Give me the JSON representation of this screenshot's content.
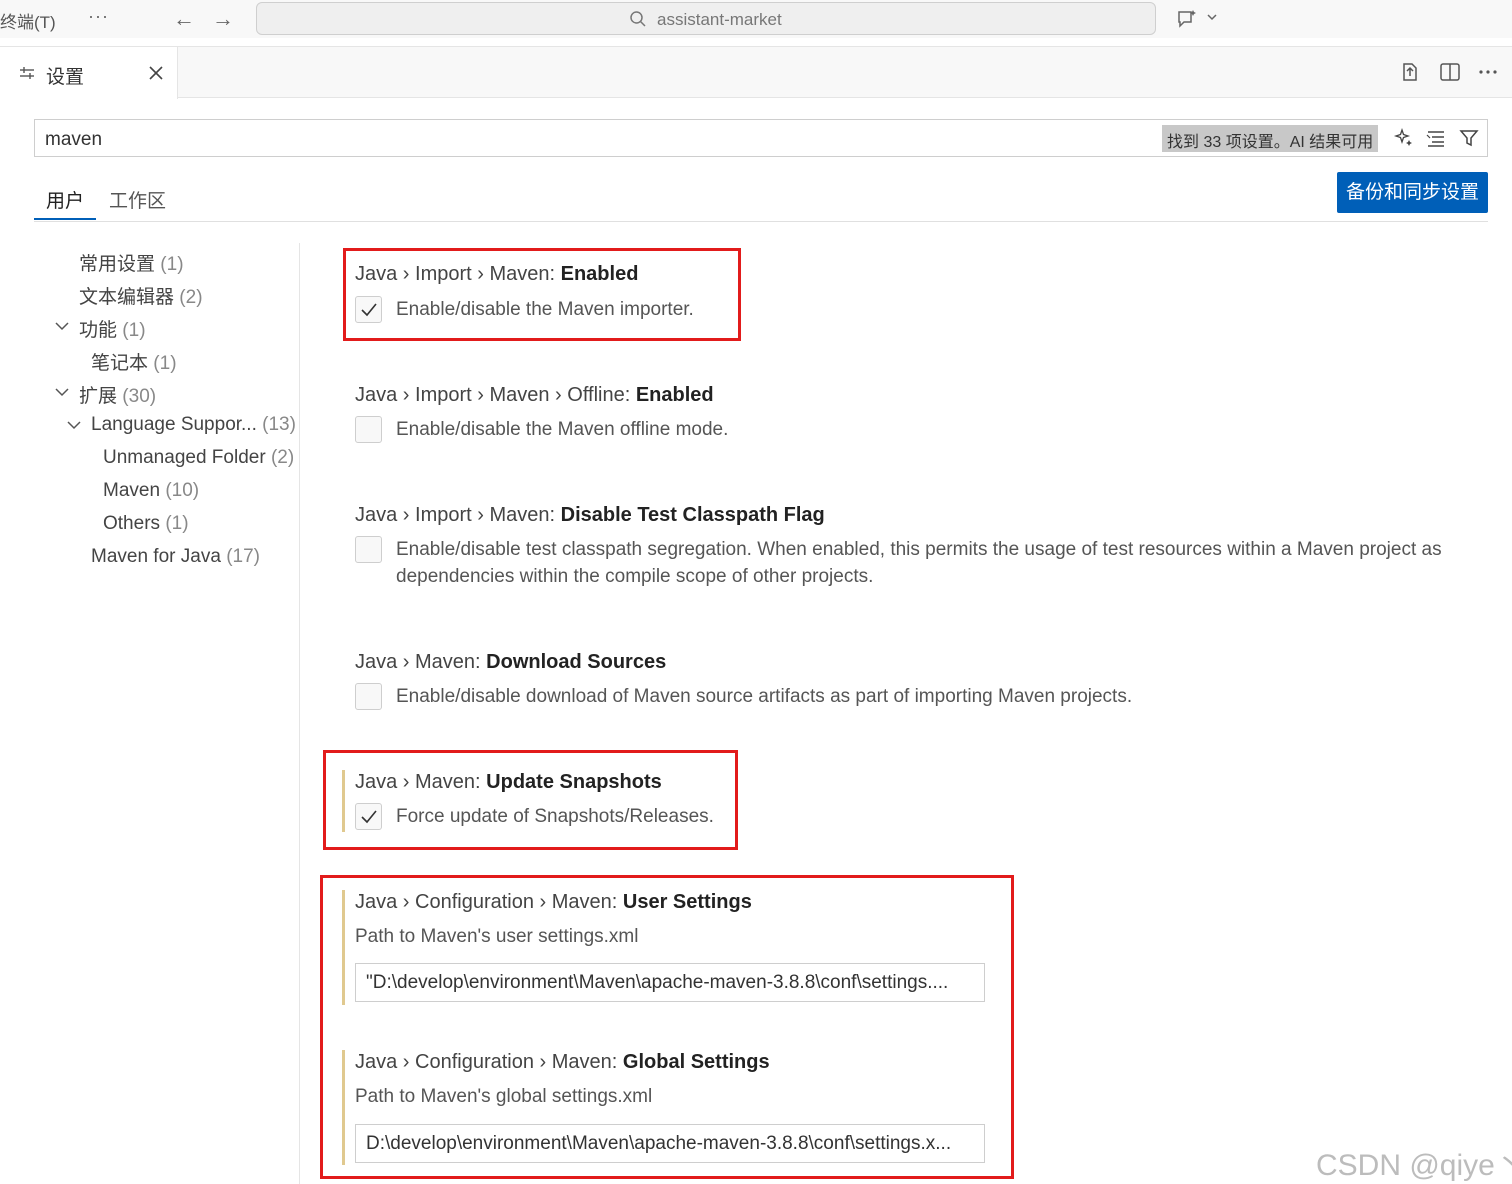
{
  "titlebar": {
    "menu_terminal": "终端(T)",
    "more": "···",
    "back": "←",
    "forward": "→",
    "command_center_text": "assistant-market"
  },
  "tab": {
    "label": "设置"
  },
  "search": {
    "value": "maven",
    "result_count": "找到 33 项设置。AI 结果可用"
  },
  "scopes": {
    "user": "用户",
    "workspace": "工作区"
  },
  "sync_button": "备份和同步设置",
  "toc": [
    {
      "label": "常用设置",
      "count": "(1)"
    },
    {
      "label": "文本编辑器",
      "count": "(2)"
    },
    {
      "label": "功能",
      "count": "(1)"
    },
    {
      "label": "笔记本",
      "count": "(1)"
    },
    {
      "label": "扩展",
      "count": "(30)"
    },
    {
      "label": "Language Suppor...",
      "count": "(13)"
    },
    {
      "label": "Unmanaged Folder",
      "count": "(2)"
    },
    {
      "label": "Maven",
      "count": "(10)"
    },
    {
      "label": "Others",
      "count": "(1)"
    },
    {
      "label": "Maven for Java",
      "count": "(17)"
    }
  ],
  "settings": [
    {
      "prefix": "Java › Import › Maven: ",
      "name": "Enabled",
      "description": "Enable/disable the Maven importer.",
      "checked": true
    },
    {
      "prefix": "Java › Import › Maven › Offline: ",
      "name": "Enabled",
      "description": "Enable/disable the Maven offline mode.",
      "checked": false
    },
    {
      "prefix": "Java › Import › Maven: ",
      "name": "Disable Test Classpath Flag",
      "description": "Enable/disable test classpath segregation. When enabled, this permits the usage of test resources within a Maven project as",
      "description2": "dependencies within the compile scope of other projects.",
      "checked": false
    },
    {
      "prefix": "Java › Maven: ",
      "name": "Download Sources",
      "description": "Enable/disable download of Maven source artifacts as part of importing Maven projects.",
      "checked": false
    },
    {
      "prefix": "Java › Maven: ",
      "name": "Update Snapshots",
      "description": "Force update of Snapshots/Releases.",
      "checked": true
    },
    {
      "prefix": "Java › Configuration › Maven: ",
      "name": "User Settings",
      "description": "Path to Maven's user settings.xml",
      "value": "\"D:\\develop\\environment\\Maven\\apache-maven-3.8.8\\conf\\settings...."
    },
    {
      "prefix": "Java › Configuration › Maven: ",
      "name": "Global Settings",
      "description": "Path to Maven's global settings.xml",
      "value": "D:\\develop\\environment\\Maven\\apache-maven-3.8.8\\conf\\settings.x..."
    }
  ],
  "watermark": "CSDN @qiye丶",
  "colors": {
    "accent": "#005fb8",
    "highlight": "#e21b1b",
    "modified": "#e0c98f"
  }
}
